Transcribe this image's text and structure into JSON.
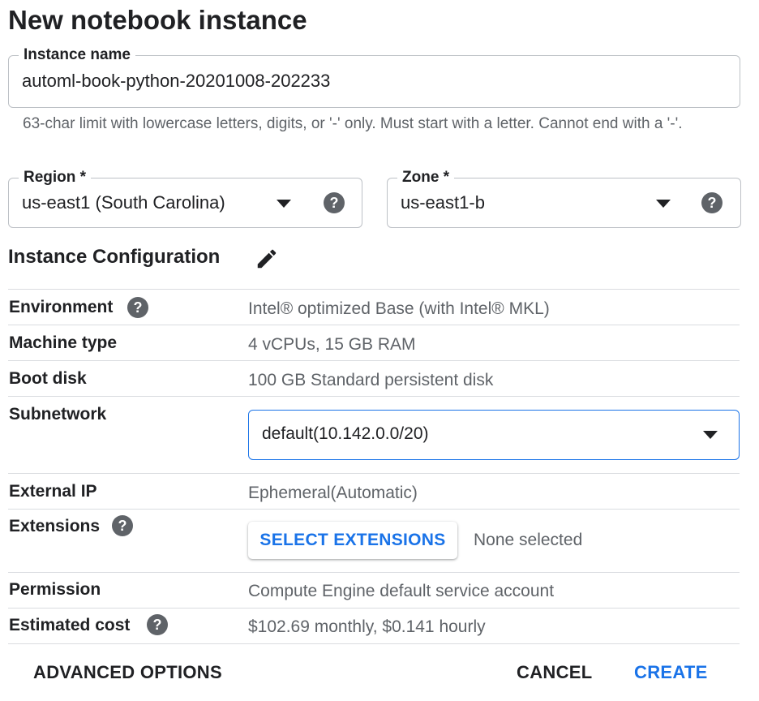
{
  "page": {
    "title": "New notebook instance"
  },
  "instance_name": {
    "label": "Instance name",
    "value": "automl-book-python-20201008-202233",
    "hint": "63-char limit with lowercase letters, digits, or '-' only. Must start with a letter. Cannot end with a '-'."
  },
  "region": {
    "label": "Region *",
    "value": "us-east1 (South Carolina)"
  },
  "zone": {
    "label": "Zone *",
    "value": "us-east1-b"
  },
  "config": {
    "section_title": "Instance Configuration",
    "environment": {
      "label": "Environment",
      "value": "Intel® optimized Base (with Intel® MKL)"
    },
    "machine_type": {
      "label": "Machine type",
      "value": "4 vCPUs, 15 GB RAM"
    },
    "boot_disk": {
      "label": "Boot disk",
      "value": "100 GB Standard persistent disk"
    },
    "subnetwork": {
      "label": "Subnetwork",
      "value": "default(10.142.0.0/20)"
    },
    "external_ip": {
      "label": "External IP",
      "value": "Ephemeral(Automatic)"
    },
    "extensions": {
      "label": "Extensions",
      "button": "SELECT EXTENSIONS",
      "status": "None selected"
    },
    "permission": {
      "label": "Permission",
      "value": "Compute Engine default service account"
    },
    "estimated_cost": {
      "label": "Estimated cost",
      "value": "$102.69 monthly, $0.141 hourly"
    }
  },
  "footer": {
    "advanced": "ADVANCED OPTIONS",
    "cancel": "CANCEL",
    "create": "CREATE"
  },
  "icons": {
    "help": "help-circle-icon",
    "dropdown": "caret-down-icon",
    "edit": "pencil-icon"
  },
  "colors": {
    "accent": "#1a73e8",
    "text": "#202124",
    "secondary": "#5f6368",
    "divider": "#dadce0"
  }
}
